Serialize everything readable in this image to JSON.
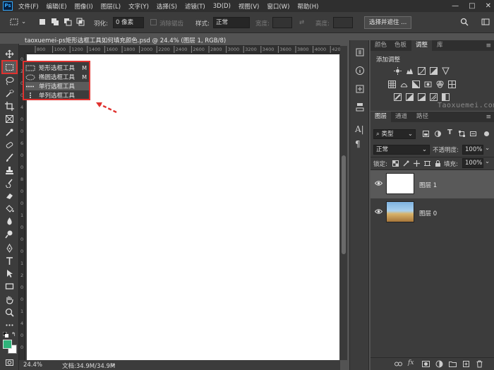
{
  "app": {
    "logo_text": "Ps"
  },
  "menu": [
    "文件(F)",
    "编辑(E)",
    "图像(I)",
    "图层(L)",
    "文字(Y)",
    "选择(S)",
    "滤镜(T)",
    "3D(D)",
    "视图(V)",
    "窗口(W)",
    "帮助(H)"
  ],
  "window_controls": {
    "minimize": "—",
    "maximize": "□",
    "close": "✕"
  },
  "options_bar": {
    "feather_label": "羽化:",
    "feather_value": "0 像素",
    "antialias_label": "消除锯齿",
    "style_label": "样式:",
    "style_value": "正常",
    "width_label": "宽度:",
    "height_label": "高度:",
    "select_mask_button": "选择并遮住 ..."
  },
  "document": {
    "tab_title": "taoxuemei-ps矩形选框工具如何填充颜色.psd @ 24.4% (图层 1, RGB/8)",
    "tab_close": "×",
    "ruler_h_labels": [
      "800",
      "1000",
      "1200",
      "1400",
      "1600",
      "1800",
      "2000",
      "2200",
      "2400",
      "2600",
      "2800",
      "3000",
      "3200",
      "3400",
      "3600",
      "3800",
      "4000",
      "4200"
    ],
    "ruler_v_labels": [
      "0",
      "2",
      "0",
      "0",
      "4",
      "0",
      "0",
      "6",
      "0",
      "0",
      "8",
      "0",
      "0",
      "1",
      "0",
      "0",
      "0",
      "1",
      "2",
      "0",
      "0",
      "1",
      "4",
      "0",
      "0"
    ]
  },
  "marquee_flyout": {
    "items": [
      {
        "label": "矩形选框工具",
        "shortcut": "M"
      },
      {
        "label": "椭圆选框工具",
        "shortcut": "M"
      },
      {
        "label": "单行选框工具",
        "shortcut": ""
      },
      {
        "label": "单列选框工具",
        "shortcut": ""
      }
    ]
  },
  "status_bar": {
    "zoom": "24.4%",
    "doc_size": "文档:34.9M/34.9M",
    "arrow": ">"
  },
  "adjustments_panel": {
    "tabs": [
      "颜色",
      "色板",
      "调整",
      "库"
    ],
    "active_tab": "调整",
    "menu_icon": "≡",
    "heading": "添加调整",
    "watermark": "Taoxuemei.com"
  },
  "layers_panel": {
    "tabs": [
      "图层",
      "通道",
      "路径"
    ],
    "active_tab": "图层",
    "menu_icon": "≡",
    "filter_kind": "类型",
    "blend_mode": "正常",
    "opacity_label": "不透明度:",
    "opacity_value": "100%",
    "lock_label": "锁定:",
    "fill_label": "填充:",
    "fill_value": "100%",
    "layers": [
      {
        "name": "图层 1",
        "selected": true
      },
      {
        "name": "图层 0",
        "selected": false
      }
    ]
  },
  "colors": {
    "foreground": "#2fb37a",
    "background": "#ffffff",
    "highlight": "#e0322f"
  }
}
